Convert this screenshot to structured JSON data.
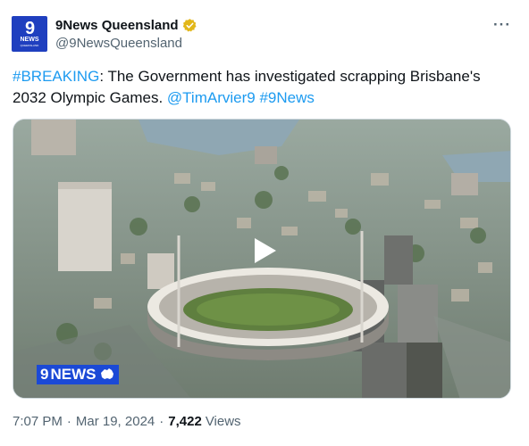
{
  "account": {
    "display_name": "9News Queensland",
    "handle": "@9NewsQueensland",
    "avatar_text": "9",
    "avatar_label": "NEWS",
    "avatar_sub": "QUEENSLAND",
    "verified_badge_icon": "gold-verified-badge-icon"
  },
  "more_menu": {
    "label": "···",
    "icon": "more-horizontal-icon"
  },
  "tweet": {
    "hashtag_breaking": "#BREAKING",
    "text": ": The Government has investigated scrapping Brisbane's 2032 Olympic Games.",
    "mention": "@TimArvier9",
    "hashtag_news": "#9News"
  },
  "media": {
    "type": "video",
    "watermark_nine": "9",
    "watermark_news": "NEWS",
    "play_icon": "play-icon"
  },
  "meta": {
    "time": "7:07 PM",
    "separator": "·",
    "date": "Mar 19, 2024",
    "separator2": "·",
    "views_count": "7,422",
    "views_label": "Views"
  },
  "colors": {
    "link": "#1d9bf0",
    "brand_blue": "#1f3fbf",
    "secondary_text": "#536471"
  }
}
